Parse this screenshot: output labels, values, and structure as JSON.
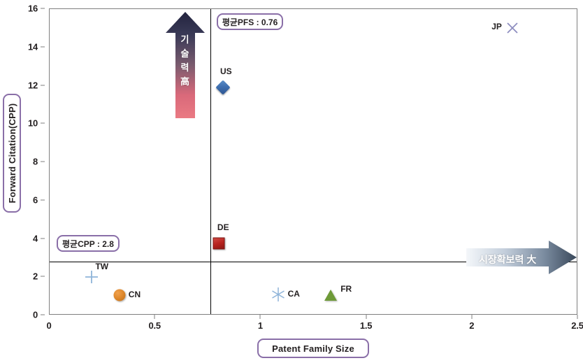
{
  "chart_data": {
    "type": "scatter",
    "title": "",
    "xlabel": "Patent Family Size",
    "ylabel": "Forward Citation(CPP)",
    "xlim": [
      0,
      2.5
    ],
    "ylim": [
      0,
      16
    ],
    "xticks": [
      "0",
      "0.5",
      "1",
      "1.5",
      "2",
      "2.5"
    ],
    "xtick_values": [
      0,
      0.5,
      1,
      1.5,
      2,
      2.5
    ],
    "yticks": [
      "0",
      "2",
      "4",
      "6",
      "8",
      "10",
      "12",
      "14",
      "16"
    ],
    "ytick_values": [
      0,
      2,
      4,
      6,
      8,
      10,
      12,
      14,
      16
    ],
    "grid": false,
    "legend": "none",
    "points": [
      {
        "name": "JP",
        "x": 2.19,
        "y": 15.0,
        "marker": "x-cross",
        "color": "#8e8ec0"
      },
      {
        "name": "US",
        "x": 0.82,
        "y": 11.9,
        "marker": "diamond",
        "color": "#3f6fb0"
      },
      {
        "name": "DE",
        "x": 0.8,
        "y": 3.75,
        "marker": "square",
        "color": "#b8231f"
      },
      {
        "name": "TW",
        "x": 0.2,
        "y": 2.0,
        "marker": "plus",
        "color": "#8fb4d9"
      },
      {
        "name": "CN",
        "x": 0.33,
        "y": 1.05,
        "marker": "circle",
        "color": "#e08a2e"
      },
      {
        "name": "CA",
        "x": 1.08,
        "y": 1.1,
        "marker": "asterisk",
        "color": "#8fb4d9"
      },
      {
        "name": "FR",
        "x": 1.33,
        "y": 1.05,
        "marker": "triangle",
        "color": "#6e9a38"
      }
    ],
    "reference_lines": [
      {
        "axis": "x",
        "value": 0.76,
        "label": "평균PFS : 0.76"
      },
      {
        "axis": "y",
        "value": 2.8,
        "label": "평균CPP : 2.8"
      }
    ],
    "annotations": [
      {
        "id": "arrow-up",
        "text": "기술력 高",
        "direction": "up"
      },
      {
        "id": "arrow-right",
        "text": "시장확보력 大",
        "direction": "right"
      }
    ]
  },
  "callouts": {
    "pfs": "평균PFS : 0.76",
    "cpp": "평균CPP : 2.8"
  },
  "annotations": {
    "up_chars": [
      "기",
      "술",
      "력",
      "高"
    ],
    "up_text": "기술력 高",
    "right_text": "시장확보력 大"
  },
  "colors": {
    "accent_purple": "#8a6fa8",
    "axis": "#7f7f7f",
    "text": "#231f20",
    "arrow_up_top": "#2b2d4a",
    "arrow_up_bottom": "#e8717a",
    "arrow_right_left": "#eef2f7",
    "arrow_right_right": "#3d4f63"
  }
}
